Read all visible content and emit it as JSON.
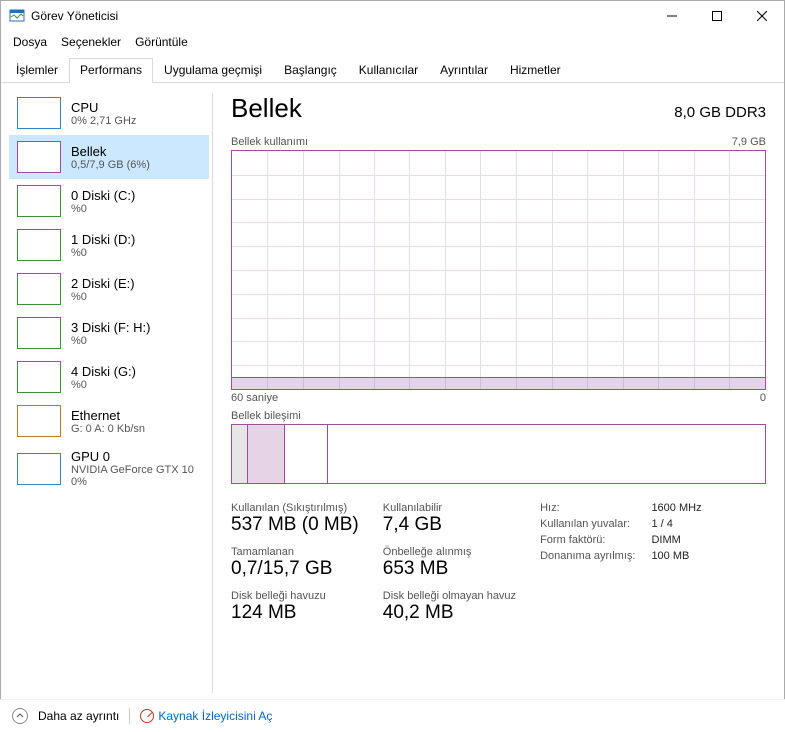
{
  "window": {
    "title": "Görev Yöneticisi"
  },
  "menu": {
    "file": "Dosya",
    "options": "Seçenekler",
    "view": "Görüntüle"
  },
  "tabs": {
    "processes": "İşlemler",
    "performance": "Performans",
    "appHistory": "Uygulama geçmişi",
    "startup": "Başlangıç",
    "users": "Kullanıcılar",
    "details": "Ayrıntılar",
    "services": "Hizmetler"
  },
  "sidebar": {
    "items": [
      {
        "title": "CPU",
        "sub": "0% 2,71 GHz",
        "color": "#3b82c4"
      },
      {
        "title": "Bellek",
        "sub": "0,5/7,9 GB (6%)",
        "color": "#9b4f96"
      },
      {
        "title": "0 Diski (C:)",
        "sub": "%0",
        "color": "#3f8f3f"
      },
      {
        "title": "1 Diski (D:)",
        "sub": "%0",
        "color": "#3f8f3f"
      },
      {
        "title": "2 Diski (E:)",
        "sub": "%0",
        "color": "#3f8f3f"
      },
      {
        "title": "3 Diski (F: H:)",
        "sub": "%0",
        "color": "#3f8f3f"
      },
      {
        "title": "4 Diski (G:)",
        "sub": "%0",
        "color": "#3f8f3f"
      },
      {
        "title": "Ethernet",
        "sub": "G: 0 A: 0 Kb/sn",
        "color": "#b97a2a"
      },
      {
        "title": "GPU 0",
        "sub": "NVIDIA GeForce GTX 10",
        "sub2": "0%",
        "color": "#3b82c4"
      }
    ]
  },
  "main": {
    "title": "Bellek",
    "headerRight": "8,0 GB DDR3",
    "usageLabel": "Bellek kullanımı",
    "usageMax": "7,9 GB",
    "axisLeft": "60 saniye",
    "axisRight": "0",
    "compLabel": "Bellek bileşimi",
    "stats": {
      "usedLabel": "Kullanılan (Sıkıştırılmış)",
      "usedVal": "537 MB (0 MB)",
      "availLabel": "Kullanılabilir",
      "availVal": "7,4 GB",
      "commitLabel": "Tamamlanan",
      "commitVal": "0,7/15,7 GB",
      "cachedLabel": "Önbelleğe alınmış",
      "cachedVal": "653 MB",
      "pagedLabel": "Disk belleği havuzu",
      "pagedVal": "124 MB",
      "nonpagedLabel": "Disk belleği olmayan havuz",
      "nonpagedVal": "40,2 MB"
    },
    "kv": {
      "speedK": "Hız:",
      "speedV": "1600 MHz",
      "slotsK": "Kullanılan yuvalar:",
      "slotsV": "1 / 4",
      "formK": "Form faktörü:",
      "formV": "DIMM",
      "hwK": "Donanıma ayrılmış:",
      "hwV": "100 MB"
    }
  },
  "footer": {
    "less": "Daha az ayrıntı",
    "resmon": "Kaynak İzleyicisini Aç"
  },
  "chart_data": {
    "type": "line",
    "title": "Bellek kullanımı",
    "xlabel": "60 saniye → 0",
    "ylabel": "GB",
    "ylim": [
      0,
      7.9
    ],
    "x": [
      60,
      0
    ],
    "series": [
      {
        "name": "Kullanılan bellek",
        "values_approx_gb": 0.5,
        "note": "flat line near bottom ~6%"
      }
    ],
    "composition": {
      "total_gb": 8.0,
      "hardware_reserved_mb": 100,
      "in_use_mb": 537,
      "cached_mb": 653,
      "available_gb": 7.4
    }
  }
}
